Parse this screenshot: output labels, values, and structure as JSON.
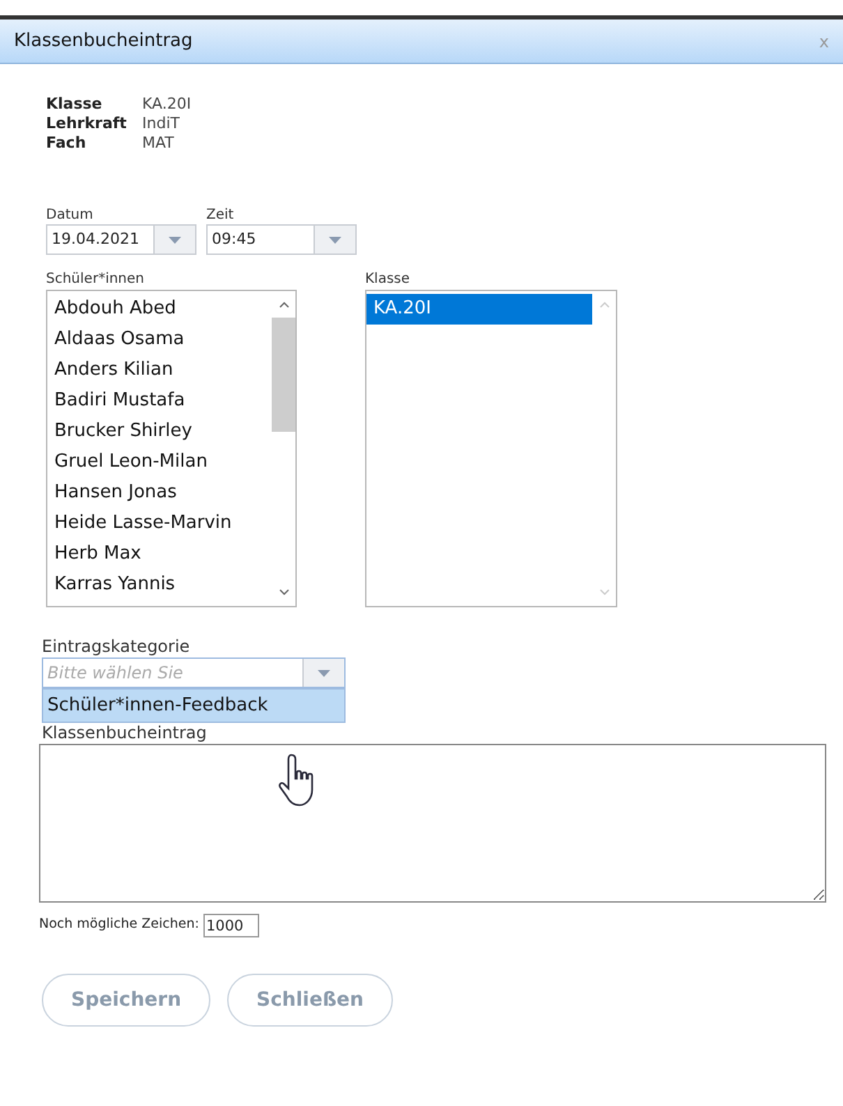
{
  "window": {
    "title": "Klassenbucheintrag",
    "close": "x"
  },
  "info": [
    {
      "label": "Klasse",
      "value": "KA.20I"
    },
    {
      "label": "Lehrkraft",
      "value": "IndiT"
    },
    {
      "label": "Fach",
      "value": "MAT"
    }
  ],
  "date": {
    "label": "Datum",
    "value": "19.04.2021"
  },
  "time": {
    "label": "Zeit",
    "value": "09:45"
  },
  "students": {
    "label": "Schüler*innen",
    "items": [
      {
        "name": "Abdouh Abed",
        "selected": false
      },
      {
        "name": "Aldaas Osama",
        "selected": false
      },
      {
        "name": "Anders Kilian",
        "selected": false
      },
      {
        "name": "Badiri Mustafa",
        "selected": false
      },
      {
        "name": "Brucker Shirley",
        "selected": false
      },
      {
        "name": "Gruel Leon-Milan",
        "selected": false
      },
      {
        "name": "Hansen Jonas",
        "selected": false
      },
      {
        "name": "Heide Lasse-Marvin",
        "selected": false
      },
      {
        "name": "Herb Max",
        "selected": false
      },
      {
        "name": "Karras Yannis",
        "selected": false
      }
    ]
  },
  "classes": {
    "label": "Klasse",
    "items": [
      {
        "name": "KA.20I",
        "selected": true
      }
    ]
  },
  "category": {
    "label": "Eintragskategorie",
    "placeholder": "Bitte wählen Sie",
    "expanded": true,
    "options": [
      {
        "label": "Schüler*innen-Feedback",
        "selected": true
      }
    ]
  },
  "entry": {
    "label": "Klassenbucheintrag"
  },
  "remaining": {
    "label": "Noch mögliche Zeichen:",
    "value": "1000"
  },
  "buttons": [
    "Speichern",
    "Schließen"
  ]
}
